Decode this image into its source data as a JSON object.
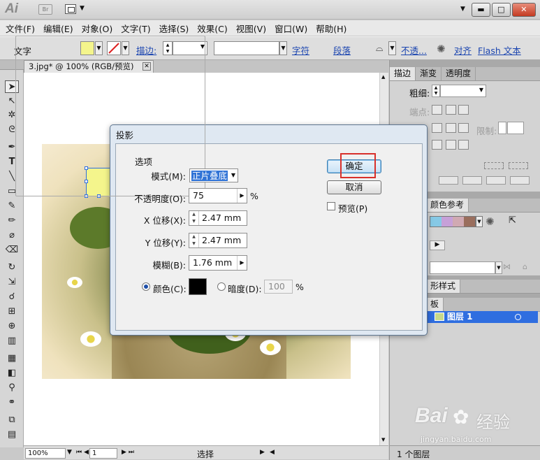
{
  "app": {
    "logo": "Ai",
    "bridge": "Br"
  },
  "window_controls": {
    "minimize": "▬",
    "maximize": "□",
    "close": "✕"
  },
  "menu": [
    "文件(F)",
    "编辑(E)",
    "对象(O)",
    "文字(T)",
    "选择(S)",
    "效果(C)",
    "视图(V)",
    "窗口(W)",
    "帮助(H)"
  ],
  "control_bar": {
    "tool_label": "文字",
    "fill_color": "#f4f58c",
    "stroke_label": "描边:",
    "char_link": "字符",
    "para_link": "段落",
    "opacity_link": "不透...",
    "align_link": "对齐",
    "flash_link": "Flash 文本"
  },
  "document_tab": {
    "title": "3.jpg* @ 100% (RGB/预览)",
    "close": "✕"
  },
  "status_bar": {
    "zoom": "100%",
    "artboard": "1",
    "status": "选择"
  },
  "panels": {
    "stroke_tabs": [
      "描边",
      "渐变",
      "透明度"
    ],
    "weight_label": "粗细:",
    "cap_label": "端点:",
    "limit_label": "限制:",
    "color_guide_tab": "颜色参考",
    "graphic_styles_tab": "形样式",
    "layers_tab": "板",
    "layer_name": "图层 1",
    "layer_count": "1 个图层"
  },
  "dialog": {
    "title": "投影",
    "group_title": "选项",
    "mode_label": "模式(M):",
    "mode_value": "正片叠底",
    "opacity_label": "不透明度(O):",
    "opacity_value": "75",
    "opacity_unit": "%",
    "x_label": "X 位移(X):",
    "x_value": "2.47 mm",
    "y_label": "Y 位移(Y):",
    "y_value": "2.47 mm",
    "blur_label": "模糊(B):",
    "blur_value": "1.76 mm",
    "color_label": "颜色(C):",
    "shadow_color": "#000000",
    "darkness_label": "暗度(D):",
    "darkness_value": "100",
    "darkness_unit": "%",
    "ok": "确定",
    "cancel": "取消",
    "preview": "预览(P)"
  },
  "watermark": {
    "brand": "Bai",
    "brand2": "经验",
    "url": "jingyan.baidu.com"
  }
}
